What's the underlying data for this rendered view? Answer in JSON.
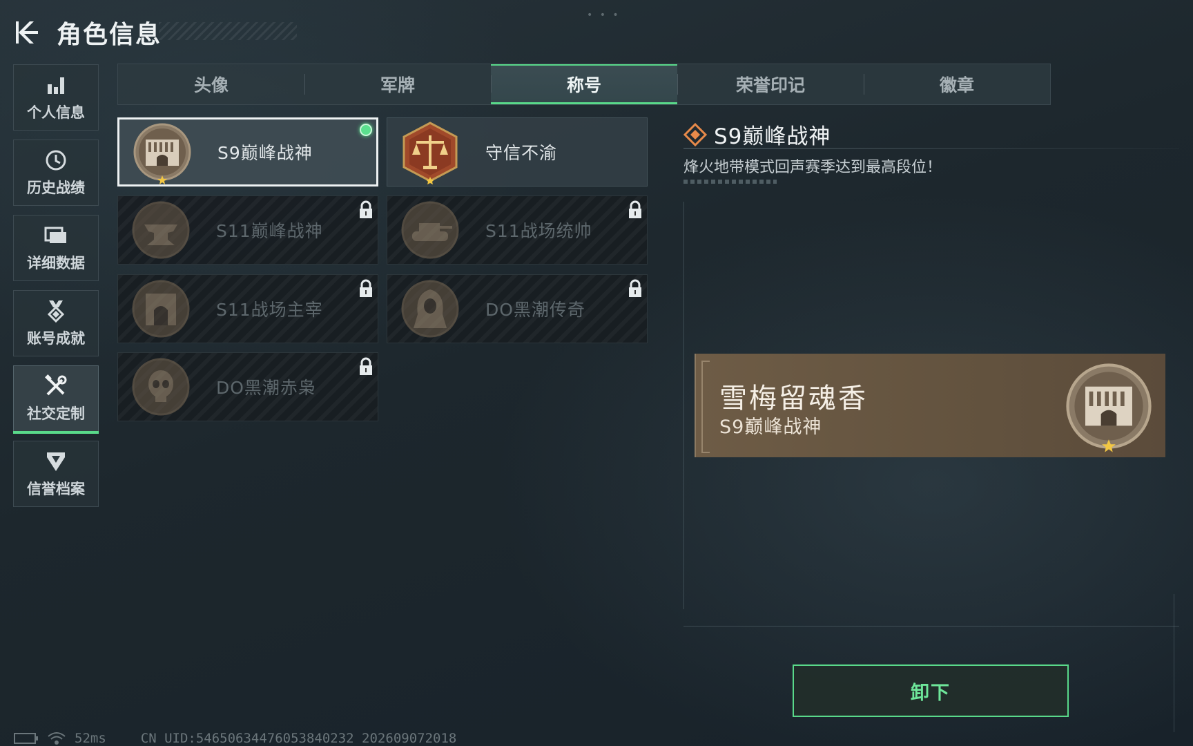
{
  "header": {
    "title": "角色信息",
    "back_icon": "back-arrow-icon"
  },
  "sidebar": {
    "items": [
      {
        "label": "个人信息",
        "icon": "bar-chart-icon",
        "active": false
      },
      {
        "label": "历史战绩",
        "icon": "clock-icon",
        "active": false
      },
      {
        "label": "详细数据",
        "icon": "folder-icon",
        "active": false
      },
      {
        "label": "账号成就",
        "icon": "medal-icon",
        "active": false
      },
      {
        "label": "社交定制",
        "icon": "tools-icon",
        "active": true
      },
      {
        "label": "信誉档案",
        "icon": "shield-icon",
        "active": false
      }
    ]
  },
  "tabs": [
    {
      "label": "头像",
      "active": false
    },
    {
      "label": "军牌",
      "active": false
    },
    {
      "label": "称号",
      "active": true
    },
    {
      "label": "荣誉印记",
      "active": false
    },
    {
      "label": "徽章",
      "active": false
    }
  ],
  "titles": [
    {
      "label": "S9巅峰战神",
      "badge": "gate-badge-icon",
      "locked": false,
      "selected": true,
      "equipped": true
    },
    {
      "label": "守信不渝",
      "badge": "scales-badge-icon",
      "locked": false,
      "selected": false,
      "equipped": false
    },
    {
      "label": "S11巅峰战神",
      "badge": "anvil-badge-icon",
      "locked": true
    },
    {
      "label": "S11战场统帅",
      "badge": "tank-badge-icon",
      "locked": true
    },
    {
      "label": "S11战场主宰",
      "badge": "arch-badge-icon",
      "locked": true
    },
    {
      "label": "DO黑潮传奇",
      "badge": "hooded-figure-badge-icon",
      "locked": true
    },
    {
      "label": "DO黑潮赤枭",
      "badge": "skull-badge-icon",
      "locked": true
    }
  ],
  "detail": {
    "title": "S9巅峰战神",
    "description": "烽火地带模式回声赛季达到最高段位！"
  },
  "nameplate": {
    "player_name": "雪梅留魂香",
    "title": "S9巅峰战神"
  },
  "actions": {
    "unequip_label": "卸下"
  },
  "footer": {
    "ping": "52ms",
    "uid": "CN UID:5465063447605384023​2 202609072018"
  },
  "colors": {
    "accent_green": "#59d98a",
    "nameplate_bg": "#6b5a45",
    "background": "#1d272d"
  }
}
